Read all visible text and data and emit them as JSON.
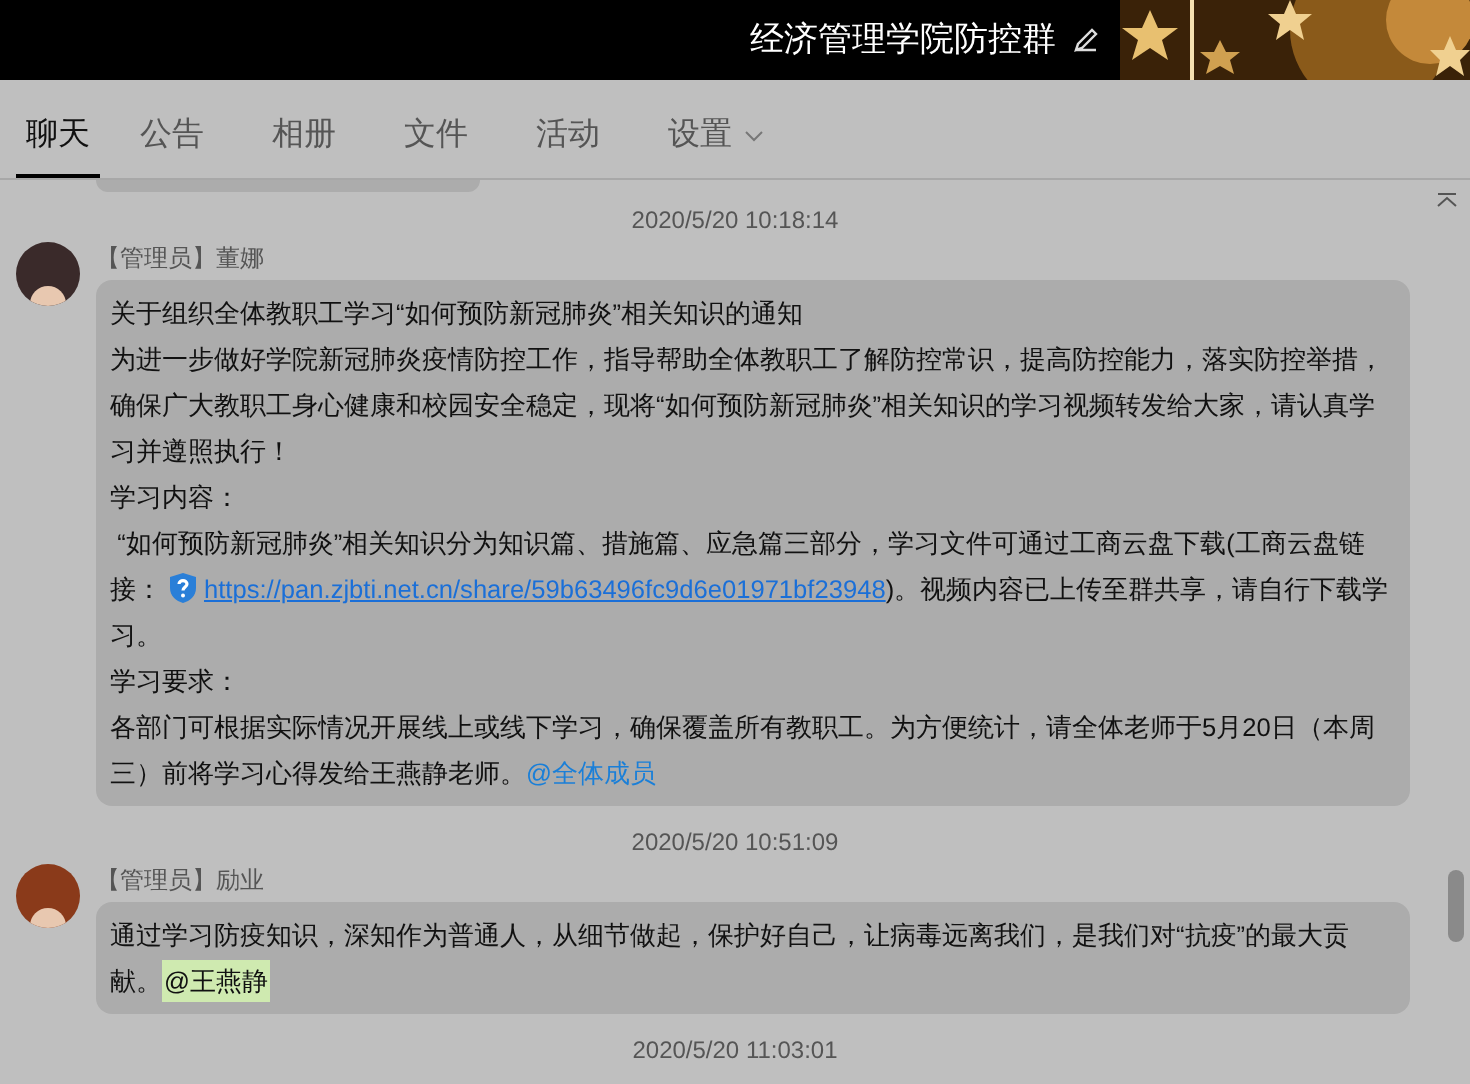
{
  "window": {
    "title": "经济管理学院防控群"
  },
  "tabs": [
    {
      "label": "聊天",
      "selected": true
    },
    {
      "label": "公告",
      "selected": false
    },
    {
      "label": "相册",
      "selected": false
    },
    {
      "label": "文件",
      "selected": false
    },
    {
      "label": "活动",
      "selected": false
    },
    {
      "label": "设置",
      "selected": false,
      "dropdown": true
    }
  ],
  "messages": [
    {
      "time": "2020/5/20 10:18:14",
      "sender": "【管理员】董娜",
      "paragraphs": [
        [
          {
            "text": "关于组织全体教职工学习“如何预防新冠肺炎”相关知识的通知"
          }
        ],
        [
          {
            "text": "为进一步做好学院新冠肺炎疫情防控工作，指导帮助全体教职工了解防控常识，提高防控能力，落实防控举措，确保广大教职工身心健康和校园安全稳定，现将“如何预防新冠肺炎”相关知识的学习视频转发给大家，请认真学习并遵照执行！"
          }
        ],
        [
          {
            "text": "学习内容："
          }
        ],
        [
          {
            "text": " “如何预防新冠肺炎”相关知识分为知识篇、措施篇、应急篇三部分，学习文件可通过工商云盘下载(工商云盘链接："
          },
          {
            "kind": "link",
            "text": "https://pan.zjbti.net.cn/share/59b63496fc9d6e01971bf23948"
          },
          {
            "text": ")。视频内容已上传至群共享，请自行下载学习。"
          }
        ],
        [
          {
            "text": "学习要求："
          }
        ],
        [
          {
            "text": "各部门可根据实际情况开展线上或线下学习，确保覆盖所有教职工。为方便统计，请全体老师于5月20日（本周三）前将学习心得发给王燕静老师。"
          },
          {
            "kind": "mention",
            "text": "@全体成员"
          }
        ]
      ]
    },
    {
      "time": "2020/5/20 10:51:09",
      "sender": "【管理员】励业",
      "paragraphs": [
        [
          {
            "text": "通过学习防疫知识，深知作为普通人，从细节做起，保护好自己，让病毒远离我们，是我们对“抗疫”的最大贡献。"
          },
          {
            "kind": "highlight",
            "text": "@王燕静"
          }
        ]
      ]
    },
    {
      "time": "2020/5/20 11:03:01"
    }
  ]
}
